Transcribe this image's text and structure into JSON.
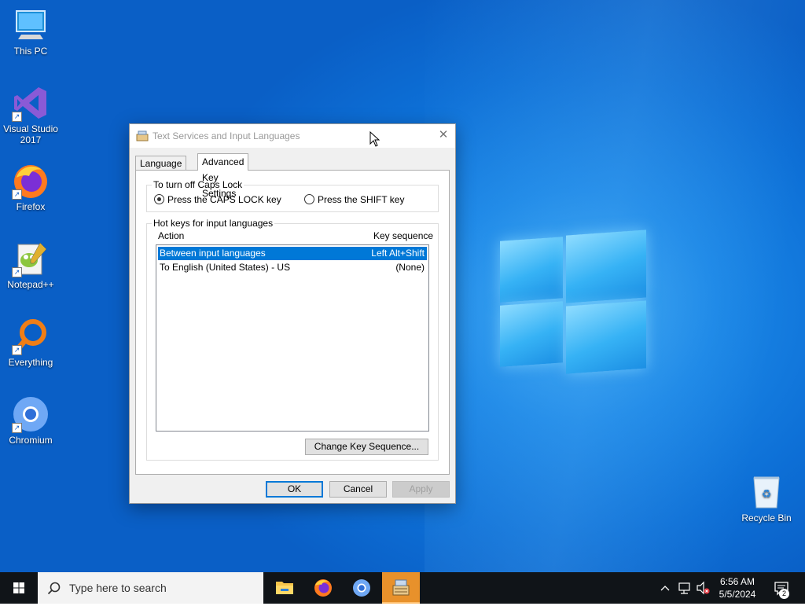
{
  "desktop": {
    "icons": [
      {
        "label_lines": [
          "This PC"
        ],
        "icon": "this-pc-icon"
      },
      {
        "label_lines": [
          "Visual Studio",
          "2017"
        ],
        "icon": "visual-studio-icon"
      },
      {
        "label_lines": [
          "Firefox"
        ],
        "icon": "firefox-icon"
      },
      {
        "label_lines": [
          "Notepad++"
        ],
        "icon": "notepad-plus-plus-icon"
      },
      {
        "label_lines": [
          "Everything"
        ],
        "icon": "everything-icon"
      },
      {
        "label_lines": [
          "Chromium"
        ],
        "icon": "chromium-icon"
      },
      {
        "label_lines": [
          "Recycle Bin"
        ],
        "icon": "recycle-bin-icon"
      }
    ]
  },
  "dialog": {
    "title": "Text Services and Input Languages",
    "close_glyph": "✕",
    "tabs": [
      "Language Bar",
      "Advanced Key Settings"
    ],
    "active_tab": "Advanced Key Settings",
    "caps_group": {
      "legend": "To turn off Caps Lock",
      "option1": "Press the CAPS LOCK key",
      "option2": "Press the SHIFT key",
      "selected": "option1"
    },
    "hotkeys_group": {
      "legend": "Hot keys for input languages",
      "col_action": "Action",
      "col_sequence": "Key sequence",
      "rows": [
        {
          "action": "Between input languages",
          "sequence": "Left Alt+Shift",
          "selected": true
        },
        {
          "action": "To English (United States) - US",
          "sequence": "(None)",
          "selected": false
        }
      ],
      "change_button": "Change Key Sequence..."
    },
    "buttons": {
      "ok": "OK",
      "cancel": "Cancel",
      "apply": "Apply"
    }
  },
  "taskbar": {
    "search_placeholder": "Type here to search",
    "apps": [
      "file-explorer-icon",
      "firefox-icon",
      "chromium-icon",
      "text-services-icon"
    ],
    "time": "6:56 AM",
    "date": "5/5/2024",
    "notification_count": "2"
  },
  "colors": {
    "selection": "#0078d7",
    "taskbar_active": "#e8912b",
    "desktop_blue": "#0d6fd6"
  }
}
